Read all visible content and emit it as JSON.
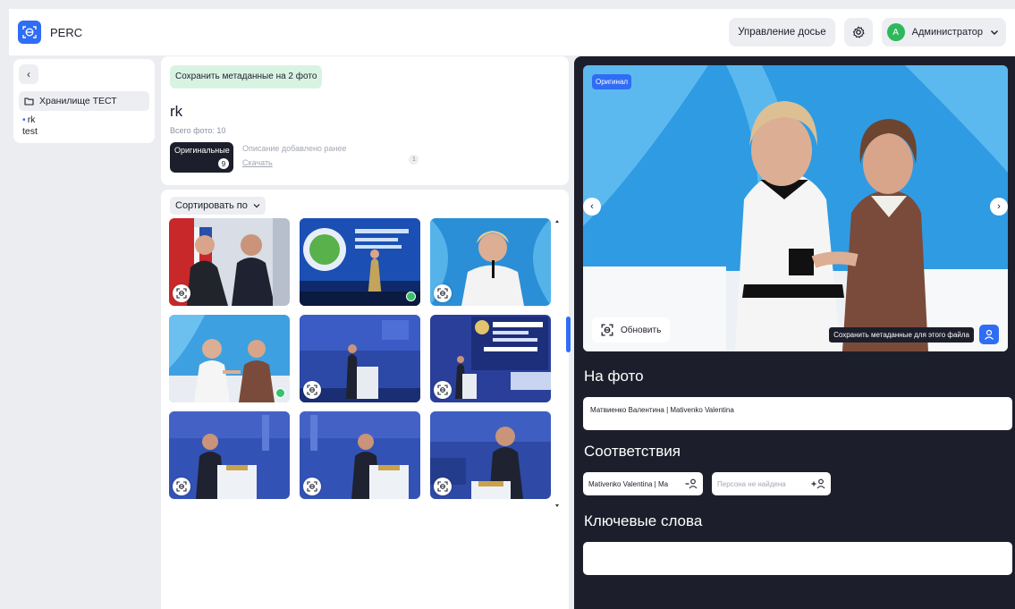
{
  "header": {
    "app_name": "PERC",
    "dossier_button": "Управление досье",
    "user_initial": "A",
    "user_name": "Администратор"
  },
  "sidebar": {
    "storage_label": "Хранилище ТЕСТ",
    "tree": [
      {
        "label": "rk",
        "selected": true
      },
      {
        "label": "test",
        "selected": false
      }
    ]
  },
  "folder": {
    "save_button": "Сохранить метаданные на 2 фото",
    "title": "rk",
    "total_photos": "Всего фото: 10",
    "originals_label": "Оригинальные",
    "originals_count": "9",
    "description_note": "Описание добавлено ранее",
    "download_link": "Скачать",
    "info_count": "1"
  },
  "gallery": {
    "sort_label": "Сортировать по",
    "thumbs": [
      {
        "scene": "award",
        "face_button": true,
        "green_dot": false
      },
      {
        "scene": "stage-blue",
        "face_button": false,
        "green_dot": true
      },
      {
        "scene": "speaker-white",
        "face_button": true,
        "green_dot": false
      },
      {
        "scene": "handshake",
        "face_button": false,
        "green_dot": true
      },
      {
        "scene": "podium-small",
        "face_button": true,
        "green_dot": false
      },
      {
        "scene": "spief-screen",
        "face_button": true,
        "green_dot": false
      },
      {
        "scene": "podium",
        "face_button": true,
        "green_dot": false
      },
      {
        "scene": "podium",
        "face_button": true,
        "green_dot": false
      },
      {
        "scene": "podium-close",
        "face_button": true,
        "green_dot": false
      }
    ]
  },
  "preview": {
    "original_tag": "Оригинал",
    "refresh_button": "Обновить",
    "save_file_label": "Сохранить метаданные для этого файла"
  },
  "details": {
    "on_photo_title": "На фото",
    "on_photo_value": "Матвиенко Валентина | Mativenko Valentina",
    "matches_title": "Соответствия",
    "match_value": "Mativenko Valentina | Ma",
    "match_placeholder": "Персона не найдена",
    "keywords_title": "Ключевые слова",
    "keywords_value": ""
  },
  "colors": {
    "accent": "#2f6df5",
    "dark_panel": "#1c1f2b",
    "success": "#35c26b",
    "save_bg": "#d9f3e3"
  }
}
